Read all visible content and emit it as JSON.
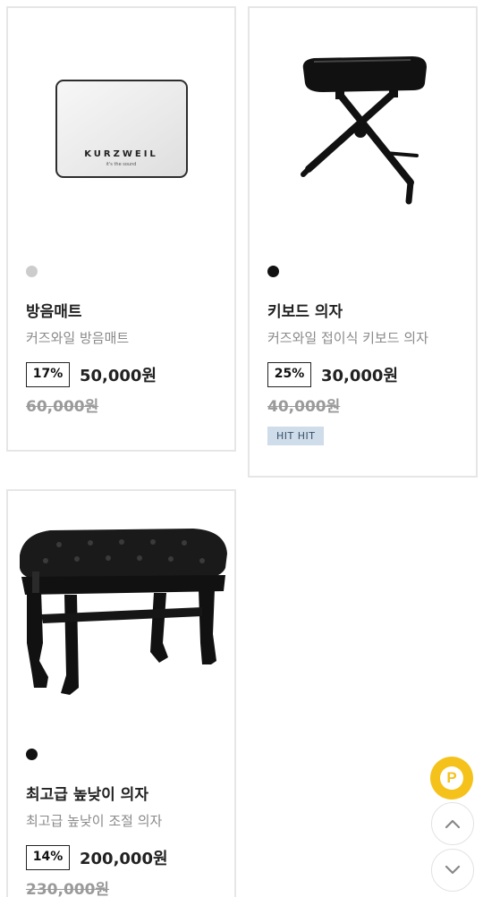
{
  "products": [
    {
      "image_alt": "KURZWEIL 방음매트",
      "image_brand": "KURZWEIL",
      "image_tagline": "it's the sound",
      "color_swatch": "#cccccc",
      "name": "방음매트",
      "description": "커즈와일 방음매트",
      "discount": "17%",
      "price": "50,000원",
      "original_price": "60,000원"
    },
    {
      "color_swatch": "#111111",
      "name": "키보드 의자",
      "description": "커즈와일 접이식 키보드 의자",
      "discount": "25%",
      "price": "30,000원",
      "original_price": "40,000원",
      "badge": "HIT HIT"
    },
    {
      "color_swatch": "#111111",
      "name": "최고급 높낮이 의자",
      "description": "최고급 높낮이 조절 의자",
      "discount": "14%",
      "price": "200,000원",
      "original_price": "230,000원"
    }
  ],
  "floating": {
    "point_label": "P",
    "point_color": "#f5c21b"
  }
}
